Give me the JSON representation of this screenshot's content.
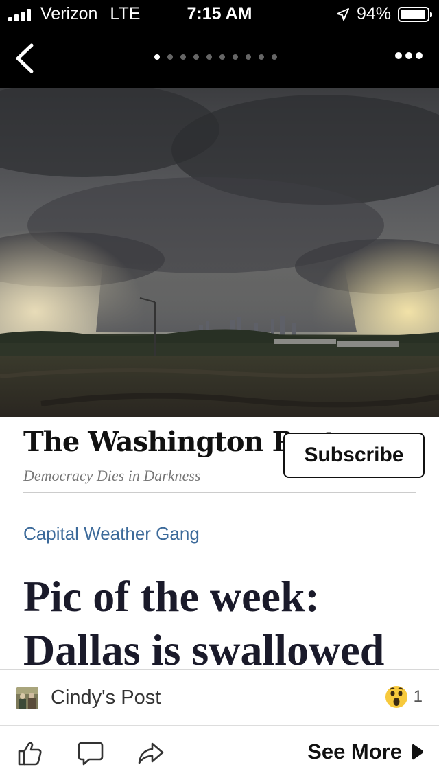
{
  "status_bar": {
    "carrier": "Verizon",
    "network": "LTE",
    "time": "7:15 AM",
    "battery_text": "94%",
    "battery_level": 0.94
  },
  "nav": {
    "page_count": 10,
    "active_page": 1
  },
  "article": {
    "publication": "The Washington Post",
    "tagline": "Democracy Dies in Darkness",
    "subscribe_label": "Subscribe",
    "section": "Capital Weather Gang",
    "headline": "Pic of the week: Dallas is swallowed by a"
  },
  "post": {
    "author": "Cindy's Post",
    "reaction_icon": "wow-emoji-icon",
    "reaction_count": "1"
  },
  "actions": {
    "like_icon": "thumbs-up-icon",
    "comment_icon": "comment-icon",
    "share_icon": "share-icon",
    "see_more_label": "See More"
  },
  "colors": {
    "section_link": "#3c6a9a",
    "bar_background": "#000000"
  }
}
